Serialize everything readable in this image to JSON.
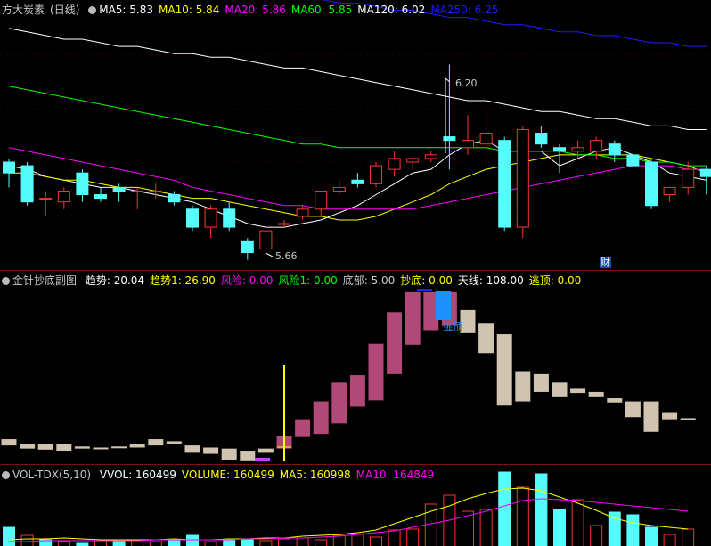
{
  "main": {
    "stock_name": "方大炭素",
    "period": "(日线)",
    "ma_labels": [
      {
        "text": "MA5: 5.83",
        "color": "#ffffff"
      },
      {
        "text": "MA10: 5.84",
        "color": "#ffff00"
      },
      {
        "text": "MA20: 5.86",
        "color": "#ff00ff"
      },
      {
        "text": "MA60: 5.85",
        "color": "#00ff00"
      },
      {
        "text": "MA120: 6.02",
        "color": "#ffffff"
      },
      {
        "text": "MA250: 6.25",
        "color": "#1e1eff"
      }
    ],
    "high_label": "6.20",
    "low_label": "5.66",
    "finance_mark": "财"
  },
  "indicator": {
    "name": "金针抄底副图",
    "values": [
      {
        "text": "趋势: 20.04",
        "color": "#ffffff"
      },
      {
        "text": "趋势1: 26.90",
        "color": "#ffff00"
      },
      {
        "text": "风险: 0.00",
        "color": "#ff00ff"
      },
      {
        "text": "风险1: 0.00",
        "color": "#00ff00"
      },
      {
        "text": "底部: 5.00",
        "color": "#c8c8c8"
      },
      {
        "text": "抄底: 0.00",
        "color": "#ffff00"
      },
      {
        "text": "天线: 108.00",
        "color": "#ffffff"
      },
      {
        "text": "逃顶: 0.00",
        "color": "#ffff00"
      }
    ],
    "escape_label": "逃顶"
  },
  "volume": {
    "name": "VOL-TDX(5,10)",
    "values": [
      {
        "text": "VVOL: 160499",
        "color": "#ffffff"
      },
      {
        "text": "VOLUME: 160499",
        "color": "#ffff00"
      },
      {
        "text": "MA5: 160998",
        "color": "#ffff00"
      },
      {
        "text": "MA10: 164849",
        "color": "#ff00ff"
      }
    ]
  },
  "colors": {
    "up": "#ff3232",
    "down": "#54fcfc",
    "ind_up": "#b04878",
    "ind_down": "#d0c4b0"
  },
  "chart_data": [
    {
      "type": "candlestick",
      "title": "方大炭素 (日线)",
      "candles": [
        {
          "o": 5.93,
          "h": 5.94,
          "l": 5.86,
          "c": 5.9
        },
        {
          "o": 5.92,
          "h": 5.93,
          "l": 5.81,
          "c": 5.82
        },
        {
          "o": 5.83,
          "h": 5.85,
          "l": 5.78,
          "c": 5.83
        },
        {
          "o": 5.82,
          "h": 5.86,
          "l": 5.8,
          "c": 5.85
        },
        {
          "o": 5.9,
          "h": 5.91,
          "l": 5.82,
          "c": 5.84
        },
        {
          "o": 5.84,
          "h": 5.86,
          "l": 5.82,
          "c": 5.83
        },
        {
          "o": 5.86,
          "h": 5.87,
          "l": 5.82,
          "c": 5.85
        },
        {
          "o": 5.85,
          "h": 5.86,
          "l": 5.8,
          "c": 5.85
        },
        {
          "o": 5.85,
          "h": 5.87,
          "l": 5.83,
          "c": 5.85
        },
        {
          "o": 5.84,
          "h": 5.85,
          "l": 5.81,
          "c": 5.82
        },
        {
          "o": 5.8,
          "h": 5.81,
          "l": 5.74,
          "c": 5.75
        },
        {
          "o": 5.75,
          "h": 5.81,
          "l": 5.72,
          "c": 5.8
        },
        {
          "o": 5.8,
          "h": 5.82,
          "l": 5.74,
          "c": 5.75
        },
        {
          "o": 5.71,
          "h": 5.72,
          "l": 5.66,
          "c": 5.68
        },
        {
          "o": 5.69,
          "h": 5.74,
          "l": 5.68,
          "c": 5.74
        },
        {
          "o": 5.76,
          "h": 5.77,
          "l": 5.75,
          "c": 5.76
        },
        {
          "o": 5.78,
          "h": 5.81,
          "l": 5.77,
          "c": 5.8
        },
        {
          "o": 5.8,
          "h": 5.85,
          "l": 5.78,
          "c": 5.85
        },
        {
          "o": 5.85,
          "h": 5.88,
          "l": 5.84,
          "c": 5.86
        },
        {
          "o": 5.88,
          "h": 5.9,
          "l": 5.86,
          "c": 5.87
        },
        {
          "o": 5.87,
          "h": 5.93,
          "l": 5.86,
          "c": 5.92
        },
        {
          "o": 5.91,
          "h": 5.96,
          "l": 5.89,
          "c": 5.94
        },
        {
          "o": 5.93,
          "h": 5.94,
          "l": 5.91,
          "c": 5.94
        },
        {
          "o": 5.94,
          "h": 5.96,
          "l": 5.93,
          "c": 5.95
        },
        {
          "o": 6.0,
          "h": 6.2,
          "l": 5.91,
          "c": 5.99
        },
        {
          "o": 5.97,
          "h": 6.06,
          "l": 5.95,
          "c": 5.99
        },
        {
          "o": 5.98,
          "h": 6.07,
          "l": 5.92,
          "c": 6.01
        },
        {
          "o": 5.99,
          "h": 6.0,
          "l": 5.74,
          "c": 5.75
        },
        {
          "o": 5.75,
          "h": 6.03,
          "l": 5.72,
          "c": 6.02
        },
        {
          "o": 6.01,
          "h": 6.03,
          "l": 5.97,
          "c": 5.98
        },
        {
          "o": 5.97,
          "h": 5.98,
          "l": 5.9,
          "c": 5.96
        },
        {
          "o": 5.96,
          "h": 5.99,
          "l": 5.94,
          "c": 5.97
        },
        {
          "o": 5.96,
          "h": 6.0,
          "l": 5.94,
          "c": 5.99
        },
        {
          "o": 5.98,
          "h": 5.99,
          "l": 5.93,
          "c": 5.95
        },
        {
          "o": 5.95,
          "h": 5.96,
          "l": 5.91,
          "c": 5.92
        },
        {
          "o": 5.93,
          "h": 5.94,
          "l": 5.8,
          "c": 5.81
        },
        {
          "o": 5.84,
          "h": 5.86,
          "l": 5.82,
          "c": 5.86
        },
        {
          "o": 5.86,
          "h": 5.93,
          "l": 5.84,
          "c": 5.91
        },
        {
          "o": 5.91,
          "h": 5.92,
          "l": 5.84,
          "c": 5.89
        }
      ],
      "ma_series": [
        {
          "name": "MA5",
          "color": "#ffffff",
          "values": [
            5.92,
            5.91,
            5.89,
            5.88,
            5.87,
            5.86,
            5.86,
            5.85,
            5.84,
            5.83,
            5.82,
            5.8,
            5.78,
            5.76,
            5.75,
            5.75,
            5.76,
            5.77,
            5.79,
            5.81,
            5.84,
            5.87,
            5.9,
            5.91,
            5.95,
            5.98,
            5.99,
            5.96,
            5.96,
            5.96,
            5.92,
            5.94,
            5.96,
            5.97,
            5.95,
            5.93,
            5.9,
            5.89,
            5.88
          ]
        },
        {
          "name": "MA10",
          "color": "#ffff00",
          "values": [
            5.9,
            5.9,
            5.89,
            5.88,
            5.88,
            5.87,
            5.86,
            5.86,
            5.85,
            5.84,
            5.83,
            5.83,
            5.82,
            5.81,
            5.8,
            5.79,
            5.78,
            5.78,
            5.77,
            5.77,
            5.78,
            5.8,
            5.82,
            5.84,
            5.87,
            5.89,
            5.91,
            5.92,
            5.93,
            5.94,
            5.95,
            5.95,
            5.95,
            5.95,
            5.95,
            5.94,
            5.93,
            5.92,
            5.9
          ]
        },
        {
          "name": "MA20",
          "color": "#ff00ff",
          "values": [
            5.97,
            5.96,
            5.95,
            5.94,
            5.93,
            5.92,
            5.91,
            5.9,
            5.89,
            5.88,
            5.86,
            5.85,
            5.84,
            5.83,
            5.82,
            5.81,
            5.81,
            5.8,
            5.8,
            5.8,
            5.8,
            5.8,
            5.8,
            5.81,
            5.82,
            5.83,
            5.84,
            5.85,
            5.86,
            5.87,
            5.88,
            5.89,
            5.9,
            5.91,
            5.92,
            5.92,
            5.92,
            5.91,
            5.91
          ]
        },
        {
          "name": "MA60",
          "color": "#00ff00",
          "values": [
            6.14,
            6.13,
            6.12,
            6.11,
            6.1,
            6.09,
            6.08,
            6.07,
            6.06,
            6.05,
            6.04,
            6.03,
            6.02,
            6.01,
            6.0,
            5.99,
            5.98,
            5.98,
            5.97,
            5.97,
            5.97,
            5.97,
            5.97,
            5.97,
            5.97,
            5.97,
            5.97,
            5.96,
            5.96,
            5.96,
            5.96,
            5.95,
            5.95,
            5.94,
            5.94,
            5.93,
            5.93,
            5.92,
            5.92
          ]
        },
        {
          "name": "MA120",
          "color": "#ffffff",
          "values": [
            6.3,
            6.29,
            6.28,
            6.27,
            6.27,
            6.26,
            6.25,
            6.25,
            6.24,
            6.23,
            6.23,
            6.22,
            6.22,
            6.21,
            6.2,
            6.19,
            6.19,
            6.18,
            6.17,
            6.16,
            6.15,
            6.14,
            6.13,
            6.12,
            6.11,
            6.1,
            6.1,
            6.09,
            6.08,
            6.07,
            6.07,
            6.06,
            6.05,
            6.05,
            6.04,
            6.03,
            6.03,
            6.02,
            6.02
          ]
        },
        {
          "name": "MA250",
          "color": "#1e1eff",
          "values": [
            6.52,
            6.51,
            6.5,
            6.49,
            6.48,
            6.47,
            6.47,
            6.46,
            6.45,
            6.44,
            6.43,
            6.43,
            6.42,
            6.41,
            6.4,
            6.4,
            6.39,
            6.38,
            6.37,
            6.37,
            6.36,
            6.35,
            6.35,
            6.34,
            6.33,
            6.33,
            6.32,
            6.31,
            6.31,
            6.3,
            6.29,
            6.29,
            6.28,
            6.28,
            6.27,
            6.26,
            6.26,
            6.25,
            6.25
          ]
        }
      ],
      "annotations": [
        {
          "text": "6.20",
          "index": 24
        },
        {
          "text": "5.66",
          "index": 13
        }
      ]
    },
    {
      "type": "bar",
      "title": "金针抄底副图",
      "bars": [
        {
          "top": 22,
          "bottom": 16
        },
        {
          "top": 17,
          "bottom": 13
        },
        {
          "top": 17,
          "bottom": 12
        },
        {
          "top": 17,
          "bottom": 11
        },
        {
          "top": 15,
          "bottom": 13
        },
        {
          "top": 14,
          "bottom": 13
        },
        {
          "top": 15,
          "bottom": 14
        },
        {
          "top": 17,
          "bottom": 14
        },
        {
          "top": 22,
          "bottom": 16
        },
        {
          "top": 20,
          "bottom": 17
        },
        {
          "top": 16,
          "bottom": 9
        },
        {
          "top": 14,
          "bottom": 8
        },
        {
          "top": 13,
          "bottom": 2
        },
        {
          "top": 11,
          "bottom": 1
        },
        {
          "top": 13,
          "bottom": 9
        },
        {
          "top": 25,
          "bottom": 13
        },
        {
          "top": 41,
          "bottom": 24
        },
        {
          "top": 58,
          "bottom": 27
        },
        {
          "top": 76,
          "bottom": 37
        },
        {
          "top": 83,
          "bottom": 53
        },
        {
          "top": 113,
          "bottom": 59
        },
        {
          "top": 143,
          "bottom": 84
        },
        {
          "top": 162,
          "bottom": 112
        },
        {
          "top": 162,
          "bottom": 125
        },
        {
          "top": 162,
          "bottom": 130
        },
        {
          "top": 145,
          "bottom": 123
        },
        {
          "top": 132,
          "bottom": 104
        },
        {
          "top": 122,
          "bottom": 54
        },
        {
          "top": 86,
          "bottom": 58
        },
        {
          "top": 84,
          "bottom": 67
        },
        {
          "top": 76,
          "bottom": 62
        },
        {
          "top": 70,
          "bottom": 66
        },
        {
          "top": 67,
          "bottom": 62
        },
        {
          "top": 61,
          "bottom": 57
        },
        {
          "top": 58,
          "bottom": 43
        },
        {
          "top": 58,
          "bottom": 29
        },
        {
          "top": 47,
          "bottom": 41
        },
        {
          "top": 42,
          "bottom": 40
        }
      ],
      "signal_line_index": 15,
      "ylim": [
        0,
        165
      ]
    },
    {
      "type": "bar",
      "title": "VOL-TDX(5,10)",
      "values": [
        86,
        77,
        72,
        70,
        68,
        71,
        70,
        71,
        70,
        72,
        77,
        70,
        72,
        73,
        71,
        73,
        74,
        72,
        77,
        78,
        75,
        83,
        84,
        112,
        122,
        104,
        106,
        148,
        131,
        146,
        106,
        117,
        88,
        103,
        100,
        86,
        78,
        84
      ],
      "up": [
        0,
        1,
        0,
        1,
        0,
        1,
        0,
        1,
        1,
        0,
        0,
        1,
        0,
        0,
        1,
        1,
        1,
        1,
        1,
        1,
        1,
        1,
        1,
        1,
        1,
        1,
        1,
        0,
        1,
        0,
        0,
        1,
        1,
        0,
        0,
        0,
        1,
        1
      ],
      "ma5": [
        72,
        73,
        73,
        74,
        73,
        72,
        72,
        72,
        72,
        73,
        72,
        72,
        73,
        73,
        74,
        74,
        76,
        77,
        78,
        80,
        83,
        90,
        97,
        104,
        110,
        118,
        124,
        129,
        130,
        127,
        120,
        113,
        105,
        96,
        91,
        88,
        86,
        84
      ],
      "ma10": [
        70,
        70,
        71,
        71,
        71,
        71,
        71,
        71,
        72,
        72,
        72,
        72,
        72,
        73,
        73,
        74,
        74,
        75,
        76,
        78,
        80,
        82,
        86,
        90,
        94,
        99,
        104,
        110,
        116,
        118,
        117,
        116,
        114,
        112,
        110,
        108,
        106,
        104
      ],
      "ylim": [
        65,
        150
      ]
    }
  ]
}
